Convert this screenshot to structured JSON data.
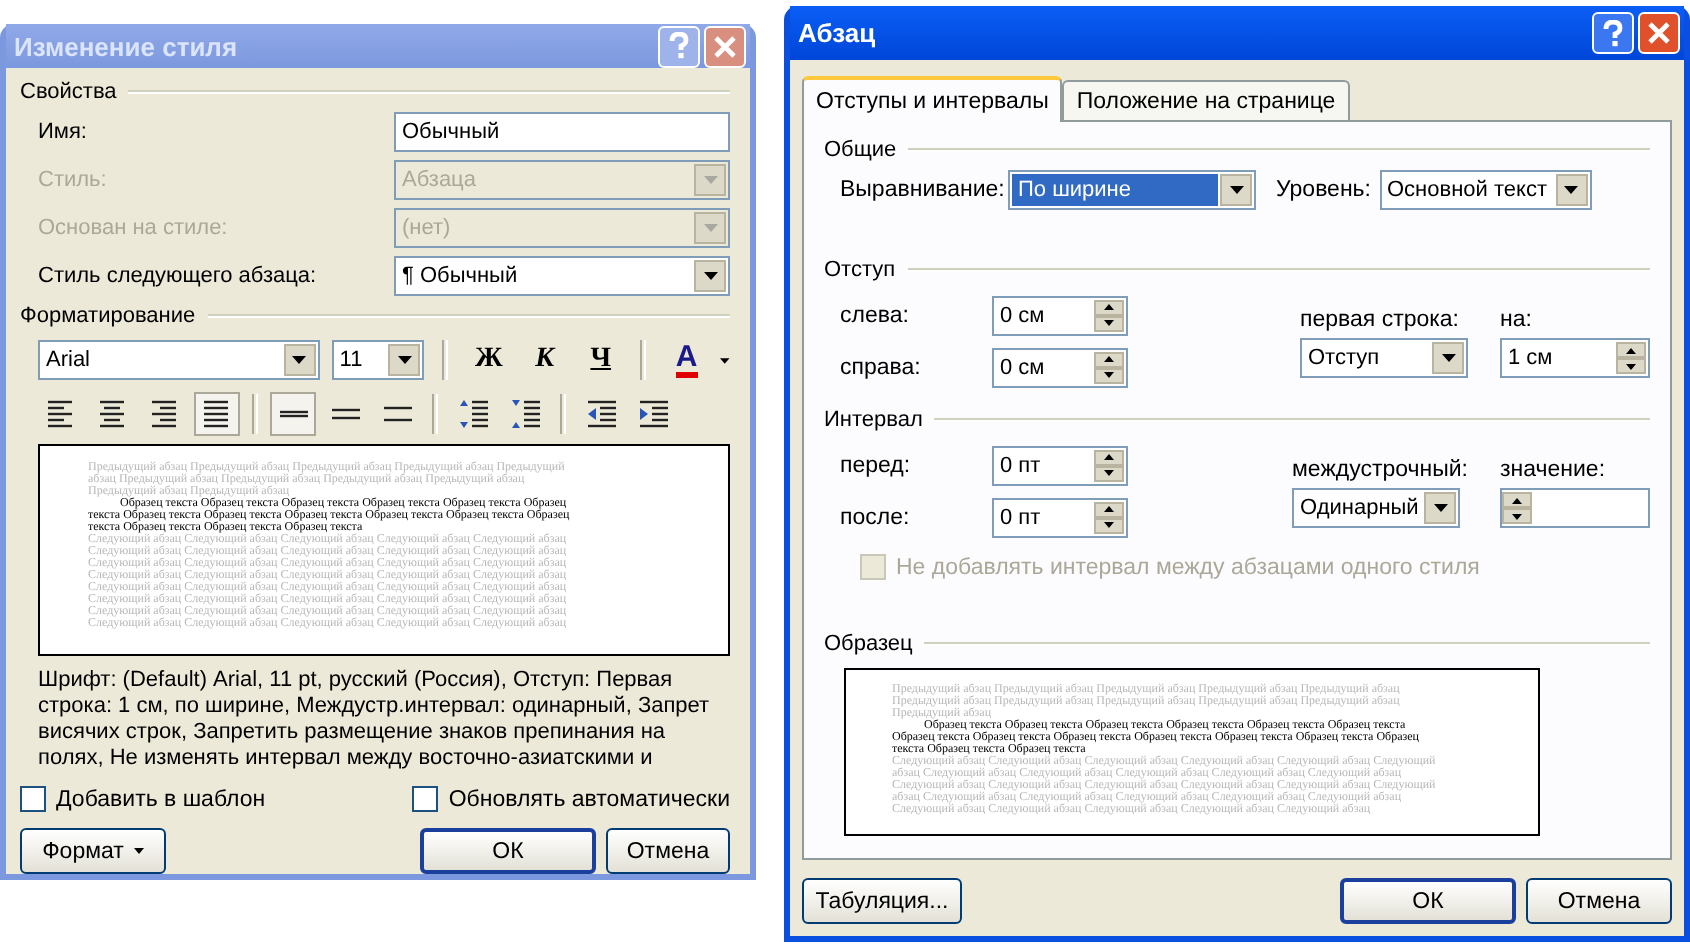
{
  "style_dialog": {
    "title": "Изменение стиля",
    "active": false,
    "properties": {
      "heading": "Свойства",
      "rows": [
        {
          "kind": "text",
          "label": "Имя:",
          "value": "Обычный",
          "disabled": false
        },
        {
          "kind": "combo",
          "label": "Стиль:",
          "value": "Абзаца",
          "disabled": true
        },
        {
          "kind": "combo",
          "label": "Основан на стиле:",
          "value": "(нет)",
          "disabled": true
        },
        {
          "kind": "combo",
          "label": "Стиль следующего абзаца:",
          "value": "¶ Обычный",
          "disabled": false
        }
      ]
    },
    "formatting": {
      "heading": "Форматирование",
      "font": "Arial",
      "size": "11",
      "style_buttons": [
        {
          "kind": "bold",
          "label": "Ж"
        },
        {
          "kind": "italic",
          "label": "К"
        },
        {
          "kind": "underline",
          "label": "Ч"
        }
      ],
      "font_color_label": "A",
      "tool_groups": [
        [
          {
            "kind": "align-left",
            "selected": false
          },
          {
            "kind": "align-center",
            "selected": false
          },
          {
            "kind": "align-right",
            "selected": false
          },
          {
            "kind": "justify",
            "selected": true
          }
        ],
        [
          {
            "kind": "single-spacing",
            "selected": true
          },
          {
            "kind": "one-half-spacing",
            "selected": false
          },
          {
            "kind": "double-spacing",
            "selected": false
          }
        ],
        [
          {
            "kind": "space-before",
            "selected": false
          },
          {
            "kind": "space-after",
            "selected": false
          }
        ],
        [
          {
            "kind": "indent-decrease",
            "selected": false
          },
          {
            "kind": "indent-increase",
            "selected": false
          }
        ]
      ]
    },
    "preview": {
      "previous": "Предыдущий абзац Предыдущий абзац Предыдущий абзац Предыдущий абзац Предыдущий абзац Предыдущий абзац Предыдущий абзац Предыдущий абзац Предыдущий абзац Предыдущий абзац Предыдущий абзац",
      "sample": "Образец текста Образец текста Образец текста Образец текста Образец текста Образец текста Образец текста Образец текста Образец текста Образец текста Образец текста Образец текста Образец текста Образец текста Образец текста",
      "next": "Следующий абзац Следующий абзац Следующий абзац Следующий абзац Следующий абзац Следующий абзац Следующий абзац Следующий абзац Следующий абзац Следующий абзац Следующий абзац Следующий абзац Следующий абзац Следующий абзац Следующий абзац Следующий абзац Следующий абзац Следующий абзац Следующий абзац Следующий абзац Следующий абзац Следующий абзац Следующий абзац Следующий абзац Следующий абзац Следующий абзац Следующий абзац Следующий абзац Следующий абзац Следующий абзац Следующий абзац Следующий абзац Следующий абзац Следующий абзац Следующий абзац Следующий абзац Следующий абзац Следующий абзац Следующий абзац Следующий абзац"
    },
    "description": "Шрифт: (Default) Arial, 11 pt, русский (Россия), Отступ: Первая строка:  1 см, по ширине, Междустр.интервал:  одинарный, Запрет висячих строк, Запретить размещение знаков препинания на полях, Не изменять интервал между восточно-азиатскими и",
    "checkboxes": [
      {
        "label": "Добавить в шаблон",
        "checked": false
      },
      {
        "label": "Обновлять автоматически",
        "checked": false
      }
    ],
    "buttons": [
      {
        "kind": "menu",
        "label": "Формат"
      },
      {
        "kind": "default",
        "label": "ОК"
      },
      {
        "kind": "plain",
        "label": "Отмена"
      }
    ]
  },
  "paragraph_dialog": {
    "title": "Абзац",
    "active": true,
    "tabs": [
      {
        "label": "Отступы и интервалы",
        "selected": true
      },
      {
        "label": "Положение на странице",
        "selected": false
      }
    ],
    "general": {
      "heading": "Общие",
      "alignment": {
        "label": "Выравнивание:",
        "value": "По ширине",
        "focused": true
      },
      "level": {
        "label": "Уровень:",
        "value": "Основной текст"
      }
    },
    "indent": {
      "heading": "Отступ",
      "left": {
        "label": "слева:",
        "value": "0 см"
      },
      "right": {
        "label": "справа:",
        "value": "0 см"
      },
      "first_line": {
        "label": "первая строка:",
        "value": "Отступ"
      },
      "by": {
        "label": "на:",
        "value": "1 см"
      }
    },
    "spacing": {
      "heading": "Интервал",
      "before": {
        "label": "перед:",
        "value": "0 пт"
      },
      "after": {
        "label": "после:",
        "value": "0 пт"
      },
      "line": {
        "label": "междустрочный:",
        "value": "Одинарный"
      },
      "at": {
        "label": "значение:"
      },
      "no_space": {
        "label": "Не добавлять интервал между абзацами одного стиля",
        "checked": false,
        "disabled": true
      }
    },
    "sample": {
      "heading": "Образец",
      "previous": "Предыдущий абзац Предыдущий абзац Предыдущий абзац Предыдущий абзац Предыдущий абзац Предыдущий абзац Предыдущий абзац Предыдущий абзац Предыдущий абзац Предыдущий абзац Предыдущий абзац",
      "sample": "Образец текста Образец текста Образец текста Образец текста Образец текста Образец текста Образец текста Образец текста Образец текста Образец текста Образец текста Образец текста Образец текста Образец текста Образец текста",
      "next": "Следующий абзац Следующий абзац Следующий абзац Следующий абзац Следующий абзац Следующий абзац Следующий абзац Следующий абзац Следующий абзац Следующий абзац Следующий абзац Следующий абзац Следующий абзац Следующий абзац Следующий абзац Следующий абзац Следующий абзац Следующий абзац Следующий абзац Следующий абзац Следующий абзац Следующий абзац Следующий абзац Следующий абзац Следующий абзац Следующий абзац Следующий абзац"
    },
    "buttons": [
      {
        "kind": "plain",
        "label": "Табуляция..."
      },
      {
        "kind": "default",
        "label": "ОК"
      },
      {
        "kind": "plain",
        "label": "Отмена"
      }
    ]
  }
}
